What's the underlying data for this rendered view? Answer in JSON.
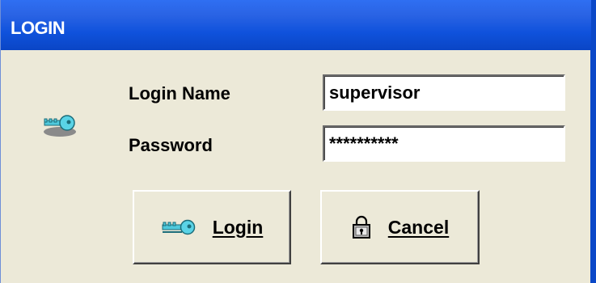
{
  "window": {
    "title": "LOGIN"
  },
  "form": {
    "login_name_label": "Login Name",
    "login_name_value": "supervisor",
    "password_label": "Password",
    "password_value": "**********"
  },
  "buttons": {
    "login_label": "Login",
    "cancel_label": "Cancel"
  },
  "icons": {
    "dialog_icon": "key-icon",
    "login_icon": "key-icon",
    "cancel_icon": "padlock-icon"
  },
  "colors": {
    "titlebar": "#0f52dc",
    "dialog_bg": "#ece9d8",
    "key": "#5ad3e6"
  }
}
